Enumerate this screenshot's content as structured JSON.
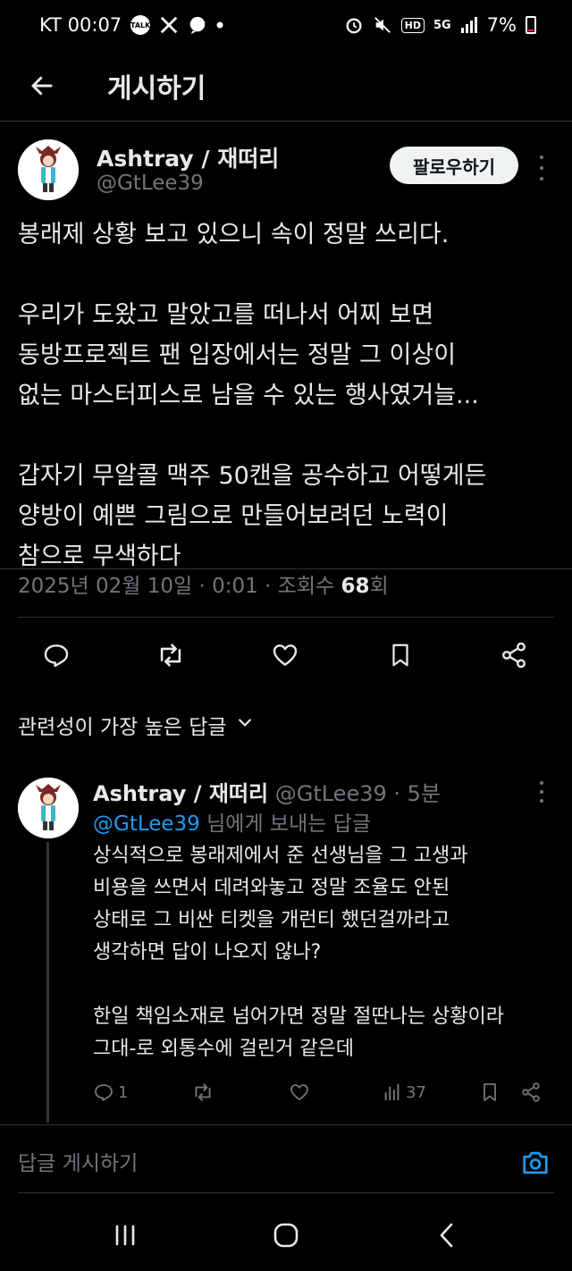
{
  "status_bar": {
    "carrier_time": "KT 00:07",
    "talk_icon_label": "TALK",
    "hd_label": "HD",
    "net_label": "5G",
    "battery": "7%",
    "battery_color": "#e0245e"
  },
  "header": {
    "title": "게시하기"
  },
  "post": {
    "author_name": "Ashtray / 재떠리",
    "author_handle": "@GtLee39",
    "follow_label": "팔로우하기",
    "body": "봉래제 상황 보고 있으니 속이 정말 쓰리다.\n\n우리가 도왔고 말았고를 떠나서 어찌 보면\n동방프로젝트 팬 입장에서는 정말 그 이상이\n없는 마스터피스로 남을 수 있는 행사였거늘...\n\n갑자기 무알콜 맥주 50캔을 공수하고 어떻게든\n양방이 예쁜 그림으로 만들어보려던 노력이\n참으로 무색하다",
    "meta_prefix": "2025년 02월 10일 · 0:01 · 조회수 ",
    "views": "68",
    "views_suffix": "회",
    "actions": [
      "reply-icon",
      "retweet-icon",
      "like-icon",
      "bookmark-icon",
      "share-icon"
    ]
  },
  "replies_sort": {
    "label": "관련성이 가장 높은 답글"
  },
  "reply": {
    "author_name": "Ashtray / 재떠리",
    "author_handle": "@GtLee39 · 5분",
    "to_mention": "@GtLee39",
    "to_suffix": " 님에게 보내는 답글",
    "body": "상식적으로 봉래제에서 준 선생님을 그 고생과\n비용을 쓰면서 데려와놓고 정말 조율도 안된\n상태로 그 비싼 티켓을 개런티 했던걸까라고\n생각하면 답이 나오지 않나?\n\n한일 책임소재로 넘어가면 정말 절딴나는 상황이라\n그대-로 외통수에 걸린거 같은데",
    "reply_count": "1",
    "view_count": "37"
  },
  "composer": {
    "placeholder": "답글 게시하기",
    "accent": "#1d9bf0"
  },
  "nav": {
    "icons": [
      "recents-icon",
      "home-icon",
      "back-icon"
    ]
  }
}
